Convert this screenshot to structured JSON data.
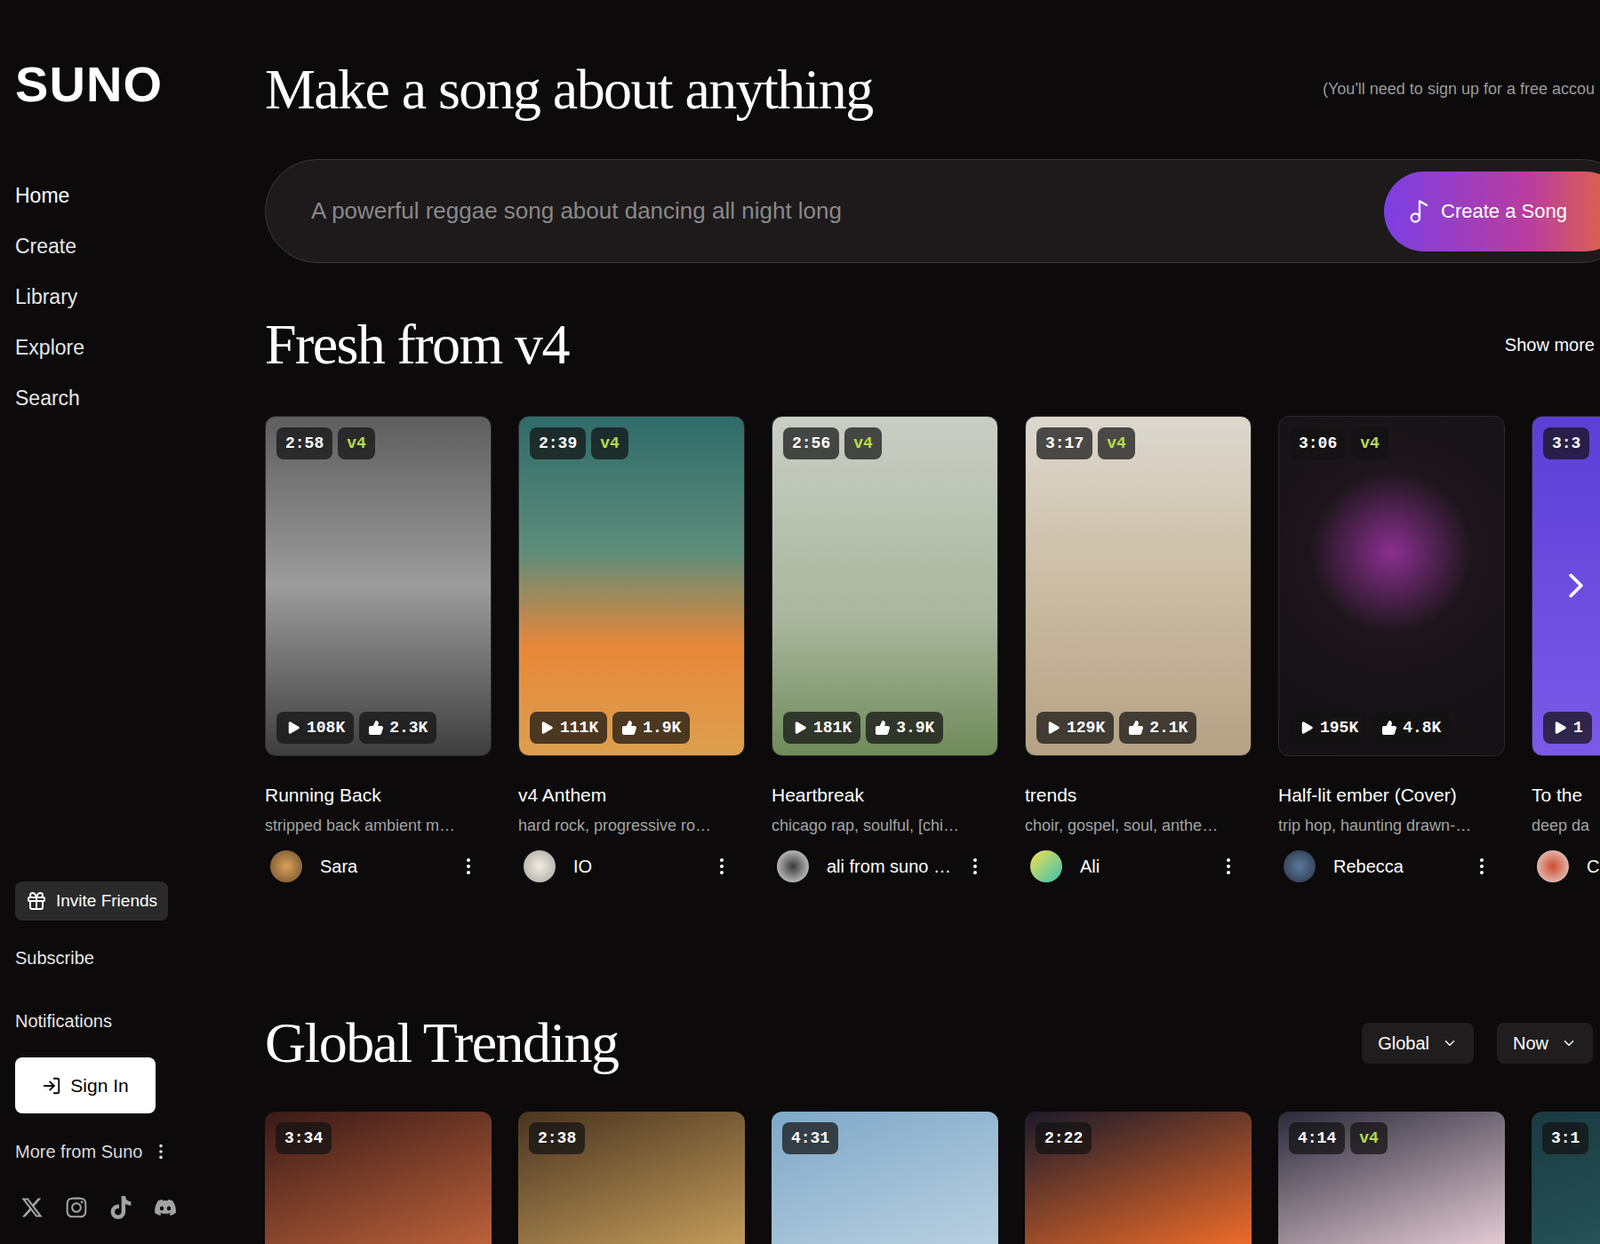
{
  "sidebar": {
    "logo": "SUNO",
    "items": [
      {
        "label": "Home",
        "selected": true
      },
      {
        "label": "Create",
        "selected": false
      },
      {
        "label": "Library",
        "selected": false
      },
      {
        "label": "Explore",
        "selected": false
      },
      {
        "label": "Search",
        "selected": false
      }
    ],
    "invite": "Invite Friends",
    "links": [
      "Subscribe",
      "Notifications"
    ],
    "sign_in": "Sign In",
    "more": "More from Suno"
  },
  "header": {
    "title": "Make a song about anything",
    "note": "(You'll need to sign up for a free accou"
  },
  "prompt": {
    "placeholder": "A powerful reggae song about dancing all night long",
    "button": "Create a Song"
  },
  "fresh": {
    "title": "Fresh from v4",
    "show_more": "Show more",
    "cards": [
      {
        "duration": "2:58",
        "version": "v4",
        "plays": "108K",
        "likes": "2.3K",
        "title": "Running Back",
        "tags": "stripped back ambient m…",
        "author": "Sara"
      },
      {
        "duration": "2:39",
        "version": "v4",
        "plays": "111K",
        "likes": "1.9K",
        "title": "v4 Anthem",
        "tags": "hard rock, progressive ro…",
        "author": "IO"
      },
      {
        "duration": "2:56",
        "version": "v4",
        "plays": "181K",
        "likes": "3.9K",
        "title": "Heartbreak",
        "tags": "chicago rap, soulful, [chi…",
        "author": "ali from suno …"
      },
      {
        "duration": "3:17",
        "version": "v4",
        "plays": "129K",
        "likes": "2.1K",
        "title": "trends",
        "tags": "choir, gospel, soul, anthe…",
        "author": "Ali"
      },
      {
        "duration": "3:06",
        "version": "v4",
        "plays": "195K",
        "likes": "4.8K",
        "title": "Half-lit ember (Cover)",
        "tags": "trip hop, haunting drawn-…",
        "author": "Rebecca"
      },
      {
        "duration": "3:3",
        "plays": "1",
        "title": "To the",
        "tags": "deep da",
        "author": "C"
      }
    ]
  },
  "trending": {
    "title": "Global Trending",
    "filters": [
      {
        "label": "Global"
      },
      {
        "label": "Now"
      }
    ],
    "cards": [
      {
        "duration": "3:34"
      },
      {
        "duration": "2:38"
      },
      {
        "duration": "4:31"
      },
      {
        "duration": "2:22"
      },
      {
        "duration": "4:14",
        "version": "v4"
      },
      {
        "duration": "3:1"
      }
    ]
  }
}
